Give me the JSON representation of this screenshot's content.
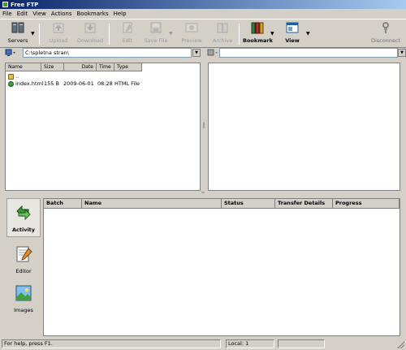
{
  "window": {
    "title": "Free FTP"
  },
  "menu": {
    "items": [
      "File",
      "Edit",
      "View",
      "Actions",
      "Bookmarks",
      "Help"
    ]
  },
  "toolbar": {
    "servers": "Servers",
    "upload": "Upload",
    "download": "Download",
    "edit": "Edit",
    "save_file": "Save File",
    "preview": "Preview",
    "archive": "Archive",
    "bookmark": "Bookmark",
    "view": "View",
    "disconnect": "Disconnect",
    "arrow": "▼"
  },
  "local_path": {
    "value": "C:\\spletna stran\\"
  },
  "remote_path": {
    "value": ""
  },
  "local_files": {
    "columns": [
      "Name",
      "Size",
      "Date",
      "Time",
      "Type"
    ],
    "rows": [
      {
        "name": "..",
        "size": "",
        "date": "",
        "time": "",
        "type": ""
      },
      {
        "name": "index.html",
        "size": "155 B",
        "date": "2009-06-01",
        "time": "08:28",
        "type": "HTML File"
      }
    ]
  },
  "sidebar": {
    "items": [
      "Activity",
      "Editor",
      "Images"
    ]
  },
  "queue": {
    "columns": [
      "Batch",
      "Name",
      "Status",
      "Transfer Details",
      "Progress"
    ]
  },
  "status": {
    "help": "For help, press F1.",
    "local": "Local: 1"
  },
  "splitter": {
    "vertical": "‖",
    "horizontal": "═"
  },
  "colors": {
    "titlebar_start": "#0a246a",
    "titlebar_end": "#a6caf0",
    "chrome": "#d4d0c8"
  }
}
